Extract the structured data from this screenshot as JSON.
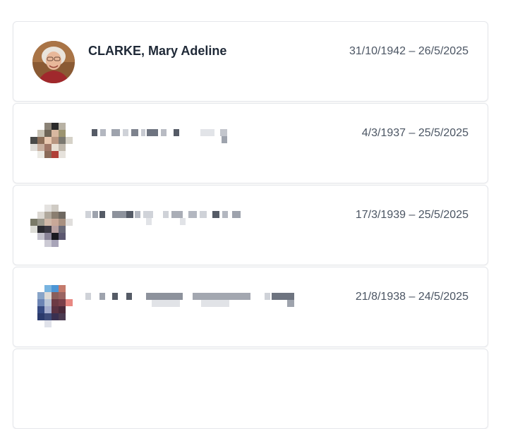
{
  "records": [
    {
      "name": "CLARKE, Mary Adeline",
      "dates": "31/10/1942 – 26/5/2025",
      "photo": "portrait"
    },
    {
      "name": "",
      "dates": "4/3/1937 – 25/5/2025",
      "photo": "pixelated"
    },
    {
      "name": "",
      "dates": "17/3/1939 – 25/5/2025",
      "photo": "pixelated"
    },
    {
      "name": "",
      "dates": "21/8/1938 – 24/5/2025",
      "photo": "pixelated"
    },
    {
      "name": "",
      "dates": "",
      "photo": ""
    }
  ],
  "colors": {
    "card_border": "#e5e7eb",
    "name_text": "#1f2937",
    "date_text": "#4b5563"
  }
}
